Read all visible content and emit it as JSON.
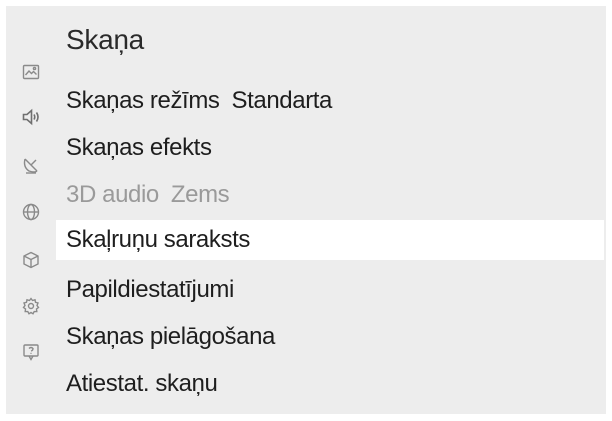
{
  "menu": {
    "title": "Skaņa",
    "items": [
      {
        "label": "Skaņas režīms",
        "value": "Standarta"
      },
      {
        "label": "Skaņas efekts",
        "value": ""
      },
      {
        "label": "3D audio",
        "value": "Zems"
      },
      {
        "label": "Skaļruņu saraksts",
        "value": ""
      },
      {
        "label": "Papildiestatījumi",
        "value": ""
      },
      {
        "label": "Skaņas pielāgošana",
        "value": ""
      },
      {
        "label": "Atiestat. skaņu",
        "value": ""
      }
    ]
  },
  "sidebar": {
    "icons": [
      "picture-icon",
      "speaker-icon",
      "satellite-dish-icon",
      "globe-icon",
      "apps-icon",
      "gear-icon",
      "help-icon"
    ]
  },
  "colors": {
    "panel_background": "#ededed",
    "highlight": "#ffffff",
    "text": "#1e1e1e",
    "disabled_text": "#9a9a9a",
    "icon": "#8a8a8a"
  }
}
